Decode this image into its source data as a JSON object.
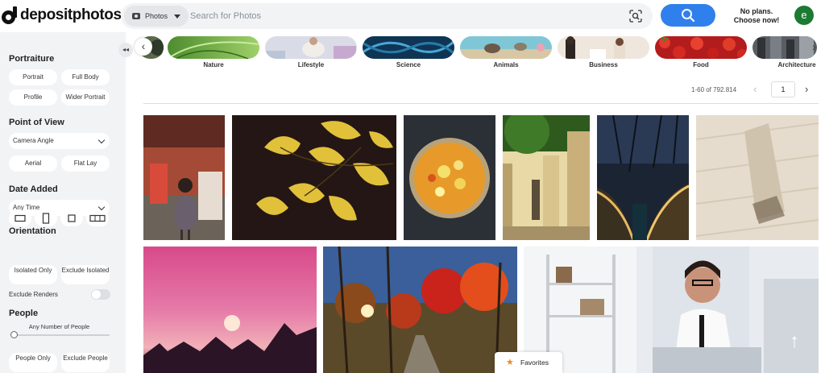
{
  "header": {
    "logo_text": "depositphotos",
    "search_type": "Photos",
    "search_placeholder": "Search for Photos",
    "plans_line1": "No plans.",
    "plans_line2": "Choose now!",
    "avatar_letter": "e",
    "accent_color": "#2f80ed"
  },
  "sidebar": {
    "portraiture": {
      "title": "Portraiture",
      "chips": [
        "Portrait",
        "Full Body",
        "Profile",
        "Wider Portrait"
      ]
    },
    "point_of_view": {
      "title": "Point of View",
      "dropdown": "Camera Angle",
      "chips": [
        "Aerial",
        "Flat Lay"
      ]
    },
    "date_added": {
      "title": "Date Added",
      "dropdown": "Any Time"
    },
    "orientation": {
      "title": "Orientation",
      "icons": [
        "horizontal-orientation-icon",
        "vertical-orientation-icon",
        "square-orientation-icon",
        "panoramic-orientation-icon"
      ],
      "isolated_only": "Isolated Only",
      "exclude_isolated": "Exclude Isolated",
      "exclude_renders": "Exclude Renders"
    },
    "people": {
      "title": "People",
      "slider_label": "Any Number of People",
      "people_only": "People Only",
      "exclude_people": "Exclude People"
    }
  },
  "categories": [
    "Nature",
    "Lifestyle",
    "Science",
    "Animals",
    "Business",
    "Food",
    "Architecture"
  ],
  "pagination": {
    "results_text": "1-60 of 792.814",
    "page": "1"
  },
  "favorites_label": "Favorites",
  "scroll_top_icon": "arrow-up-icon"
}
